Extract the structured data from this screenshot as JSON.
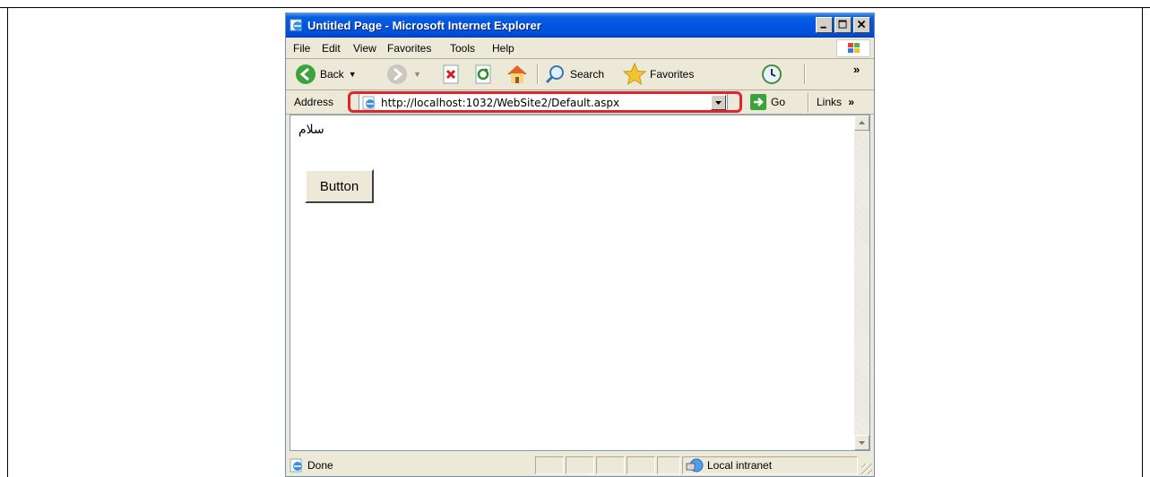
{
  "window": {
    "title": "Untitled Page - Microsoft Internet Explorer",
    "controls": [
      "minimize-icon",
      "maximize-icon",
      "close-icon"
    ]
  },
  "menubar": {
    "items": [
      "File",
      "Edit",
      "View",
      "Favorites",
      "Tools",
      "Help"
    ]
  },
  "toolbar": {
    "back_label": "Back",
    "search_label": "Search",
    "favorites_label": "Favorites",
    "overflow": "»"
  },
  "addressbar": {
    "label": "Address",
    "url": "http://localhost:1032/WebSite2/Default.aspx",
    "go_label": "Go",
    "links_label": "Links",
    "links_overflow": "»",
    "highlight_color": "#e0242b"
  },
  "page": {
    "text": "سلام",
    "button_label": "Button"
  },
  "statusbar": {
    "status": "Done",
    "zone": "Local intranet"
  },
  "colors": {
    "titlebar": "#0053e1",
    "chrome": "#ece9d8"
  }
}
